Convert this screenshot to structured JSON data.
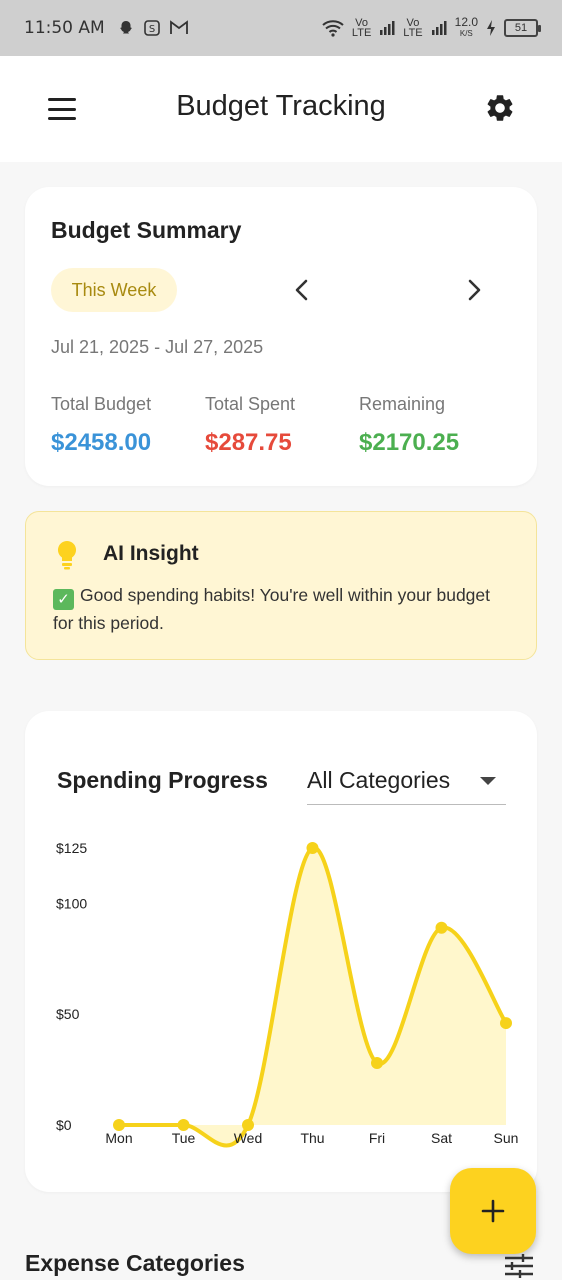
{
  "status_bar": {
    "time": "11:50 AM",
    "network_speed": "12.0",
    "network_speed_unit": "K/S",
    "battery": "51",
    "volte_label": "Vo",
    "lte_label": "LTE"
  },
  "appbar": {
    "title": "Budget Tracking"
  },
  "summary": {
    "title": "Budget Summary",
    "period": "This Week",
    "date_range": "Jul 21, 2025 - Jul 27, 2025",
    "stats": [
      {
        "label": "Total Budget",
        "value": "$2458.00",
        "color": "#3a93d8"
      },
      {
        "label": "Total Spent",
        "value": "$287.75",
        "color": "#e64a3b"
      },
      {
        "label": "Remaining",
        "value": "$2170.25",
        "color": "#4caf50"
      }
    ]
  },
  "insight": {
    "title": "AI Insight",
    "text": "Good spending habits! You're well within your budget for this period."
  },
  "progress": {
    "title": "Spending Progress",
    "category_selected": "All Categories"
  },
  "chart_data": {
    "type": "area",
    "categories": [
      "Mon",
      "Tue",
      "Wed",
      "Thu",
      "Fri",
      "Sat",
      "Sun"
    ],
    "values": [
      0,
      0,
      0,
      125,
      28,
      89,
      46
    ],
    "y_ticks": [
      "$125",
      "$100",
      "$50",
      "$0"
    ],
    "y_tick_values": [
      125,
      100,
      50,
      0
    ],
    "ylim": [
      0,
      125
    ],
    "color": "#f6d21a",
    "fill": "#fff7cc"
  },
  "fab": {
    "label": "+"
  },
  "section": {
    "title": "Expense Categories"
  },
  "colors": {
    "accent": "#fdd21f",
    "chip_bg": "#fff6d6",
    "chip_text": "#a88a10"
  }
}
